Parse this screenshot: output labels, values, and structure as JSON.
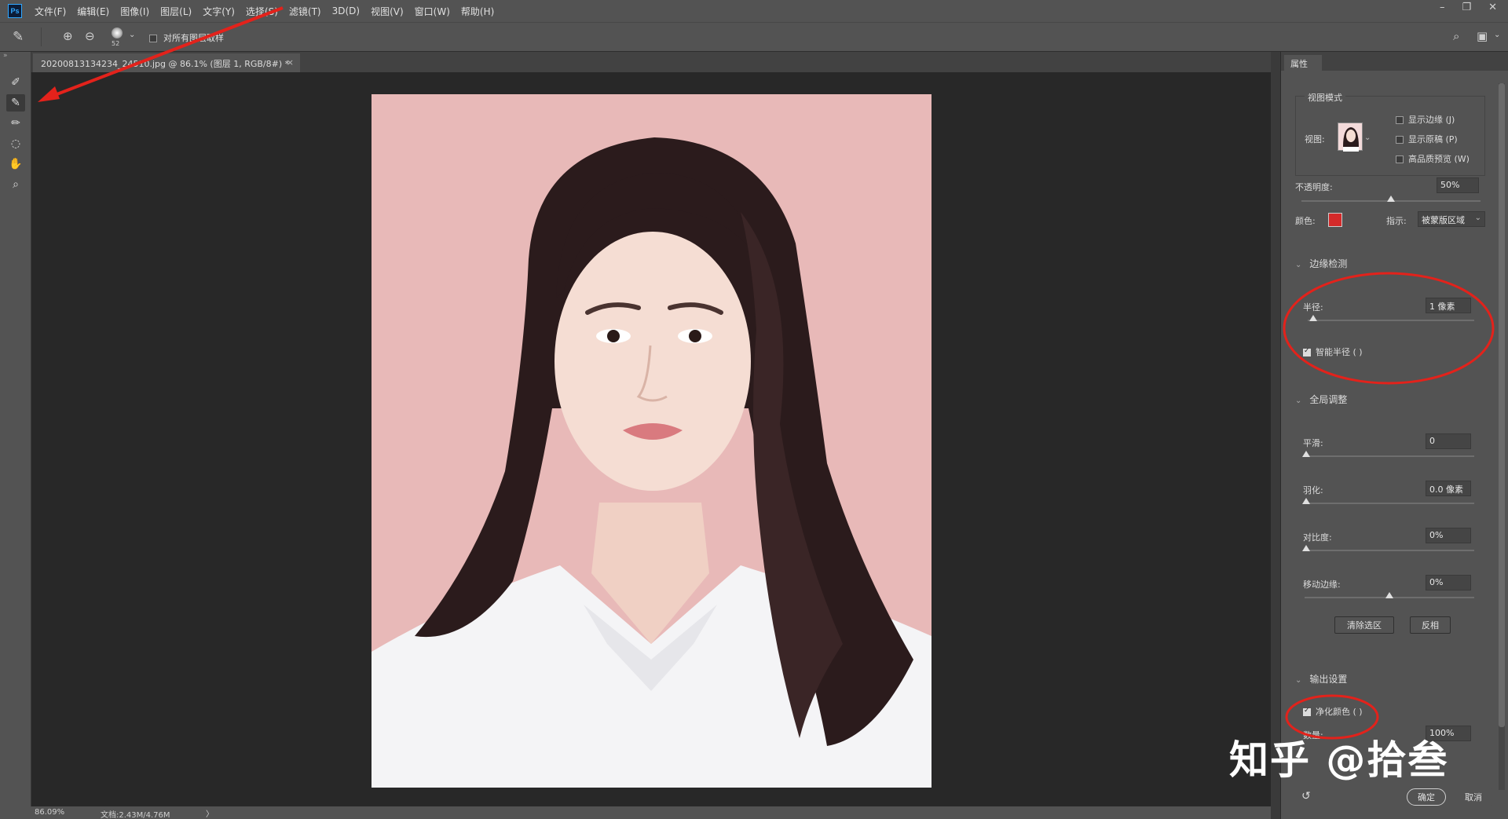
{
  "app": {
    "logo_text": "Ps",
    "menu": [
      "文件(F)",
      "编辑(E)",
      "图像(I)",
      "图层(L)",
      "文字(Y)",
      "选择(S)",
      "滤镜(T)",
      "3D(D)",
      "视图(V)",
      "窗口(W)",
      "帮助(H)"
    ],
    "window_controls": [
      "–",
      "❐",
      "✕"
    ]
  },
  "options_bar": {
    "brush_size": "52",
    "sample_all_layers_label": "对所有图层取样",
    "sample_all_layers_checked": false
  },
  "document": {
    "tab_title": "20200813134234_24510.jpg @ 86.1% (图层 1, RGB/8#) *",
    "tab_close": "×"
  },
  "status": {
    "zoom": "86.09%",
    "doc_info": "文档:2.43M/4.76M",
    "arrow": "〉"
  },
  "panel": {
    "tab": "属性",
    "view_mode": {
      "title": "视图模式",
      "view_label": "视图:",
      "show_edge": "显示边缘 (J)",
      "show_original": "显示原稿 (P)",
      "hq_preview": "高品质预览 (W)"
    },
    "opacity_label": "不透明度:",
    "opacity_value": "50%",
    "opacity_level": 0.5,
    "color_label": "颜色:",
    "color_value": "#d42a2a",
    "indicate_label": "指示:",
    "indicate_value": "被蒙版区域",
    "edge_detection": {
      "title": "边缘检测",
      "radius_label": "半径:",
      "radius_value": "1 像素",
      "radius_level": 0.01,
      "smart_radius_label": "智能半径 ( )",
      "smart_radius_checked": true
    },
    "global_refine": {
      "title": "全局调整",
      "smooth_label": "平滑:",
      "smooth_value": "0",
      "feather_label": "羽化:",
      "feather_value": "0.0 像素",
      "contrast_label": "对比度:",
      "contrast_value": "0%",
      "shift_edge_label": "移动边缘:",
      "shift_edge_value": "0%",
      "clear_selection": "清除选区",
      "invert": "反相"
    },
    "output": {
      "title": "输出设置",
      "decontaminate_label": "净化颜色 ( )",
      "decontaminate_checked": true,
      "amount_label": "数量:",
      "amount_value": "100%"
    },
    "ok": "确定",
    "cancel": "取消"
  },
  "watermark": "知乎 @拾叁",
  "colors": {
    "accent_red": "#e3221b",
    "photo_bg": "#e8b9b8"
  }
}
